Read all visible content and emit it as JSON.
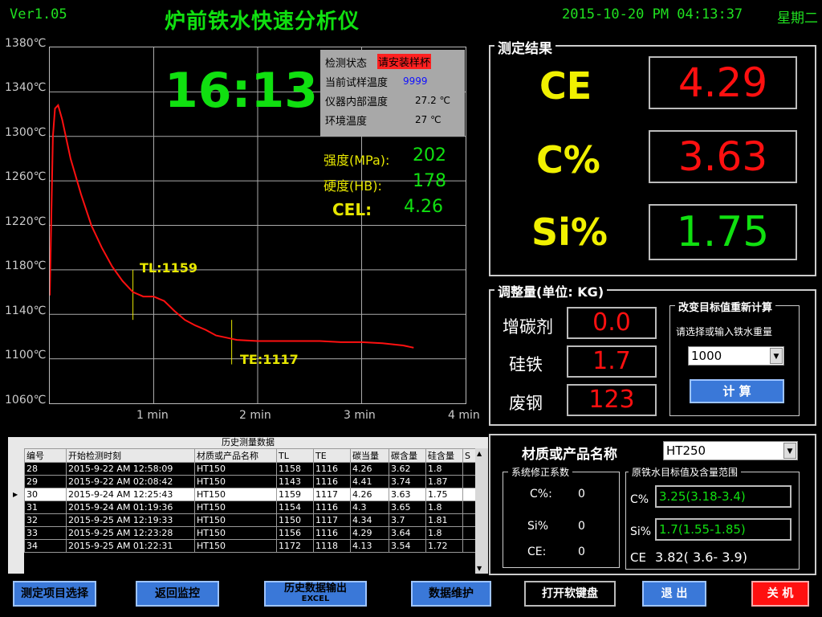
{
  "header": {
    "version": "Ver1.05",
    "title": "炉前铁水快速分析仪",
    "datetime": "2015-10-20 PM 04:13:37",
    "weekday": "星期二"
  },
  "chart": {
    "y_ticks": [
      "1380℃",
      "1340℃",
      "1300℃",
      "1260℃",
      "1220℃",
      "1180℃",
      "1140℃",
      "1100℃",
      "1060℃"
    ],
    "x_ticks": [
      "1 min",
      "2 min",
      "3 min",
      "4 min"
    ],
    "tl_label": "TL:1159",
    "te_label": "TE:1117",
    "clock": "16:13",
    "status": {
      "state_label": "检测状态",
      "state_value": "请安装样杯",
      "sample_temp_label": "当前试样温度",
      "sample_temp_value": "9999",
      "internal_temp_label": "仪器内部温度",
      "internal_temp_value": "27.2 ℃",
      "ambient_temp_label": "环境温度",
      "ambient_temp_value": "27 ℃"
    },
    "strength_label": "强度(MPa):",
    "strength_value": "202",
    "hardness_label": "硬度(HB):",
    "hardness_value": "178",
    "cel_label": "CEL:",
    "cel_value": "4.26"
  },
  "chart_data": {
    "type": "line",
    "xlabel": "",
    "ylabel": "",
    "xlim": [
      0,
      4
    ],
    "ylim": [
      1060,
      1380
    ],
    "x": [
      0,
      0.03,
      0.05,
      0.08,
      0.12,
      0.2,
      0.3,
      0.4,
      0.5,
      0.6,
      0.7,
      0.8,
      0.9,
      0.95,
      1.0,
      1.05,
      1.1,
      1.2,
      1.3,
      1.4,
      1.5,
      1.6,
      1.7,
      1.8,
      2.0,
      2.2,
      2.4,
      2.6,
      2.8,
      3.0,
      3.2,
      3.4,
      3.5
    ],
    "y": [
      1157,
      1300,
      1325,
      1328,
      1315,
      1280,
      1248,
      1220,
      1200,
      1183,
      1170,
      1160,
      1156,
      1156,
      1156,
      1154,
      1152,
      1143,
      1135,
      1130,
      1126,
      1121,
      1119,
      1117,
      1116,
      1116,
      1116,
      1116,
      1115,
      1115,
      1114,
      1112,
      1110
    ]
  },
  "results": {
    "title": "测定结果",
    "ce_label": "CE",
    "ce_value": "4.29",
    "c_label": "C%",
    "c_value": "3.63",
    "si_label": "Si%",
    "si_value": "1.75",
    "colors": {
      "ce": "#ff1010",
      "c": "#ff1010",
      "si": "#10e010"
    }
  },
  "adjust": {
    "title": "调整量(单位: KG)",
    "carb_label": "增碳剂",
    "carb_value": "0.0",
    "fesi_label": "硅铁",
    "fesi_value": "1.7",
    "scrap_label": "废钢",
    "scrap_value": "123",
    "recalc_title": "改变目标值重新计算",
    "recalc_hint": "请选择或输入铁水重量",
    "weight_value": "1000",
    "calc_button": "计 算"
  },
  "history": {
    "title": "历史测量数据",
    "columns": [
      "编号",
      "开始检测时刻",
      "材质或产品名称",
      "TL",
      "TE",
      "碳当量",
      "碳含量",
      "硅含量",
      "S"
    ],
    "rows": [
      [
        "28",
        "2015-9-22 AM 12:58:09",
        "HT150",
        "1158",
        "1116",
        "4.26",
        "3.62",
        "1.8"
      ],
      [
        "29",
        "2015-9-22 AM 02:08:42",
        "HT150",
        "1143",
        "1116",
        "4.41",
        "3.74",
        "1.87"
      ],
      [
        "30",
        "2015-9-24 AM 12:25:43",
        "HT150",
        "1159",
        "1117",
        "4.26",
        "3.63",
        "1.75"
      ],
      [
        "31",
        "2015-9-24 AM 01:19:36",
        "HT150",
        "1154",
        "1116",
        "4.3",
        "3.65",
        "1.8"
      ],
      [
        "32",
        "2015-9-25 AM 12:19:33",
        "HT150",
        "1150",
        "1117",
        "4.34",
        "3.7",
        "1.81"
      ],
      [
        "33",
        "2015-9-25 AM 12:23:28",
        "HT150",
        "1156",
        "1116",
        "4.29",
        "3.64",
        "1.8"
      ],
      [
        "34",
        "2015-9-25 AM 01:22:31",
        "HT150",
        "1172",
        "1118",
        "4.13",
        "3.54",
        "1.72"
      ]
    ],
    "selected_index": 2
  },
  "material": {
    "label": "材质或产品名称",
    "value": "HT250",
    "corr_title": "系统修正系数",
    "corr_c_label": "C%:",
    "corr_c_value": "0",
    "corr_si_label": "Si%",
    "corr_si_value": "0",
    "corr_ce_label": "CE:",
    "corr_ce_value": "0",
    "target_title": "原铁水目标值及含量范围",
    "target_c_label": "C%",
    "target_c_value": "3.25(3.18-3.4)",
    "target_si_label": "Si%",
    "target_si_value": "1.7(1.55-1.85)",
    "target_ce_label": "CE",
    "target_ce_value": "3.82( 3.6- 3.9)"
  },
  "buttons": {
    "select_item": "测定项目选择",
    "return_monitor": "返回监控",
    "export_line1": "历史数据输出",
    "export_line2": "EXCEL",
    "maintain": "数据维护",
    "keyboard": "打开软键盘",
    "exit": "退 出",
    "shutdown": "关 机"
  }
}
